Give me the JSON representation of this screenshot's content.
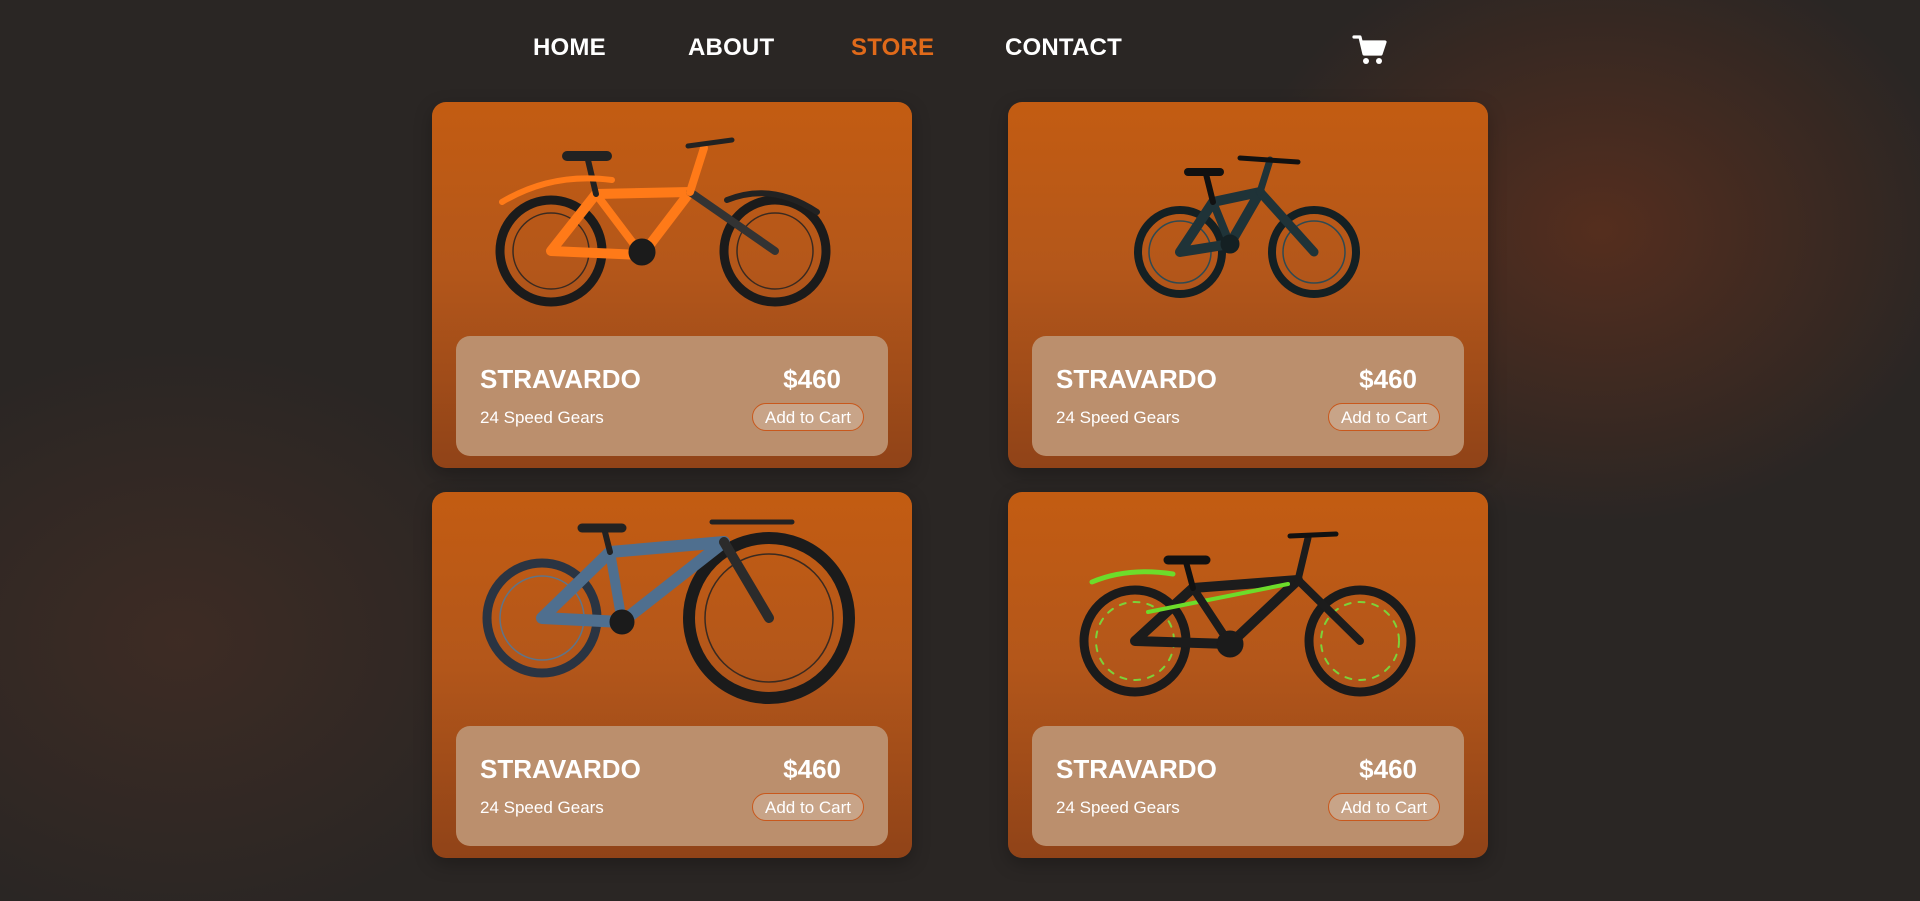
{
  "nav": {
    "items": [
      {
        "label": "HOME",
        "active": false
      },
      {
        "label": "ABOUT",
        "active": false
      },
      {
        "label": "STORE",
        "active": true
      },
      {
        "label": "CONTACT",
        "active": false
      }
    ],
    "cart_icon": "shopping-cart-icon"
  },
  "colors": {
    "accent": "#e06a1a",
    "card_top": "#c35c12",
    "card_bottom": "#904318",
    "info_panel": "#bb8f6d",
    "background": "#2a2624"
  },
  "products": [
    {
      "name": "STRAVARDO",
      "desc": "24 Speed Gears",
      "price": "$460",
      "button": "Add to Cart",
      "image": "orange-mountain-bike"
    },
    {
      "name": "STRAVARDO",
      "desc": "24 Speed Gears",
      "price": "$460",
      "button": "Add to Cart",
      "image": "dark-full-suspension-bike"
    },
    {
      "name": "STRAVARDO",
      "desc": "24 Speed Gears",
      "price": "$460",
      "button": "Add to Cart",
      "image": "blue-full-suspension-bike"
    },
    {
      "name": "STRAVARDO",
      "desc": "24 Speed Gears",
      "price": "$460",
      "button": "Add to Cart",
      "image": "black-green-mountain-bike"
    }
  ]
}
